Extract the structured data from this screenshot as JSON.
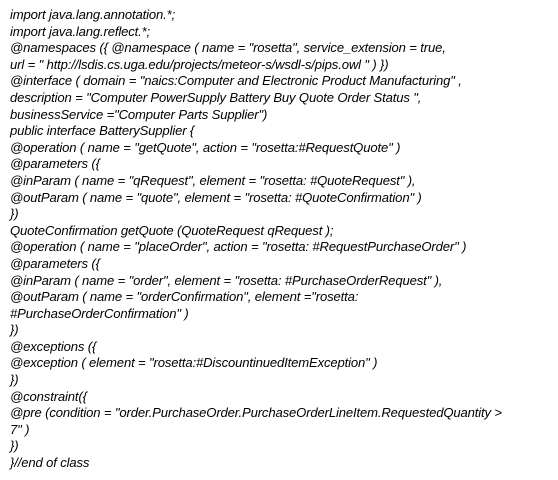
{
  "document": {
    "lines": [
      "import java.lang.annotation.*;",
      "import java.lang.reflect.*;",
      "@namespaces ({ @namespace ( name = \"rosetta\", service_extension = true,",
      "url = \" http://lsdis.cs.uga.edu/projects/meteor-s/wsdl-s/pips.owl \" ) })",
      "@interface ( domain = \"naics:Computer and Electronic Product Manufacturing\" ,",
      "description = \"Computer PowerSupply Battery Buy Quote Order Status \",",
      "businessService =\"Computer Parts Supplier\")",
      "public interface BatterySupplier {",
      "@operation ( name = \"getQuote\", action = \"rosetta:#RequestQuote\" )",
      "@parameters ({",
      "@inParam ( name = \"qRequest\", element = \"rosetta: #QuoteRequest\" ),",
      "@outParam ( name = \"quote\", element = \"rosetta: #QuoteConfirmation\" )",
      "})",
      "QuoteConfirmation getQuote (QuoteRequest qRequest );",
      "@operation ( name = \"placeOrder\", action = \"rosetta: #RequestPurchaseOrder\" )",
      "@parameters ({",
      "@inParam ( name = \"order\", element = \"rosetta: #PurchaseOrderRequest\" ),",
      "@outParam ( name = \"orderConfirmation\", element =\"rosetta:",
      "#PurchaseOrderConfirmation\" )",
      "})",
      "@exceptions ({",
      "@exception ( element = \"rosetta:#DiscountinuedItemException\" )",
      "})",
      "@constraint({",
      "@pre (condition = \"order.PurchaseOrder.PurchaseOrderLineItem.RequestedQuantity >",
      "7\" )",
      "})",
      "}//end of class"
    ]
  }
}
